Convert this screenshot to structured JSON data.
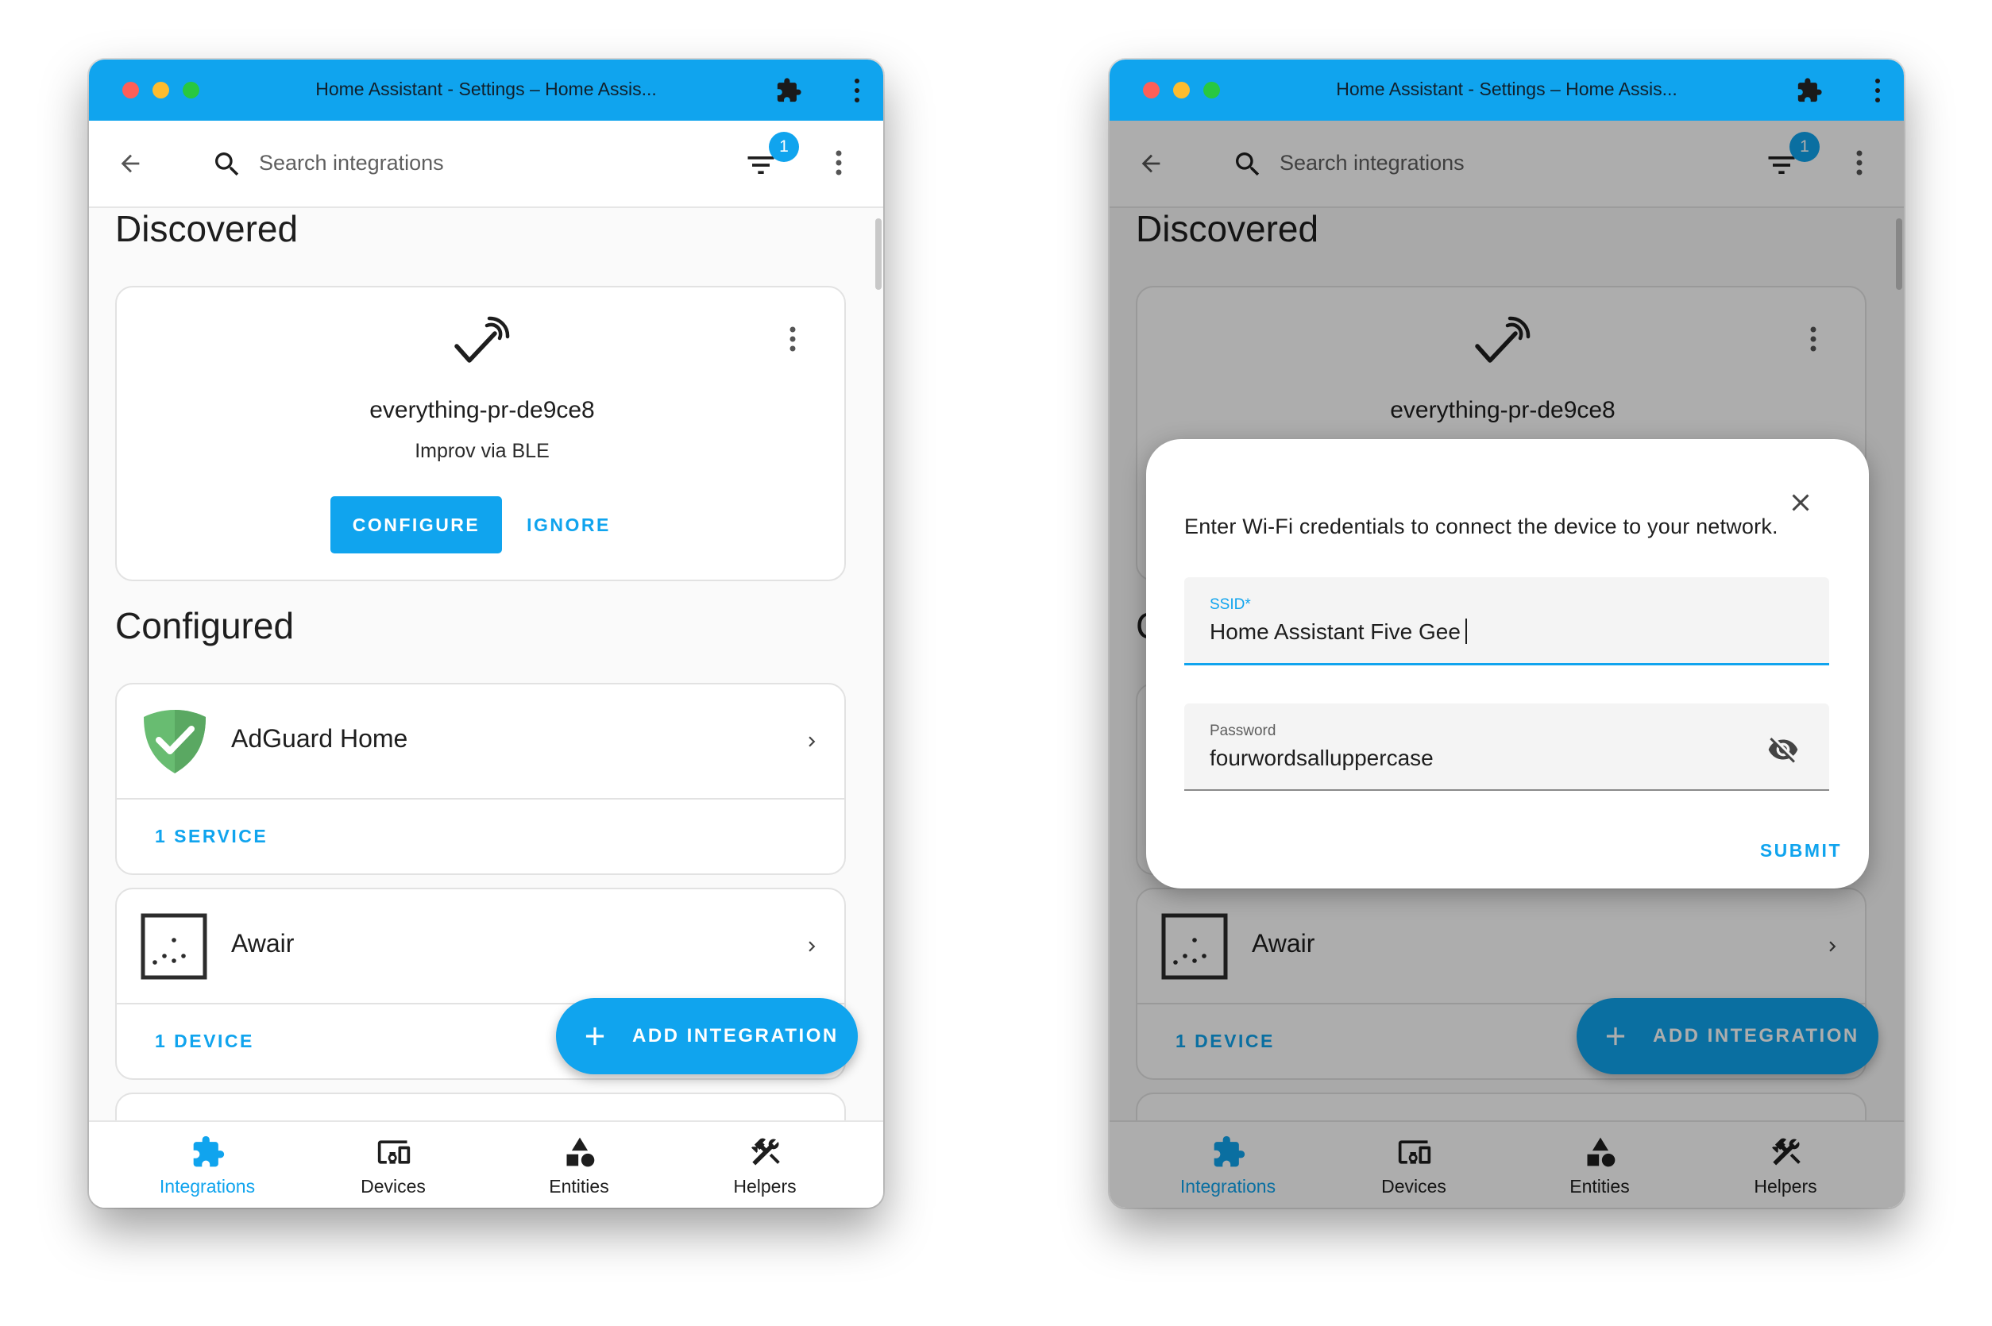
{
  "window": {
    "title": "Home Assistant - Settings – Home Assis..."
  },
  "toolbar": {
    "search_placeholder": "Search integrations",
    "filter_count": "1"
  },
  "discovered": {
    "heading": "Discovered",
    "card": {
      "name": "everything-pr-de9ce8",
      "subtitle": "Improv via BLE",
      "configure_label": "CONFIGURE",
      "ignore_label": "IGNORE"
    }
  },
  "configured": {
    "heading": "Configured",
    "items": [
      {
        "name": "AdGuard Home",
        "link": "1 SERVICE",
        "icon": "adguard-shield-icon"
      },
      {
        "name": "Awair",
        "link": "1 DEVICE",
        "icon": "awair-icon"
      }
    ]
  },
  "fab": {
    "label": "ADD INTEGRATION"
  },
  "nav": {
    "items": [
      {
        "label": "Integrations",
        "icon": "puzzle-icon",
        "active": true
      },
      {
        "label": "Devices",
        "icon": "devices-icon"
      },
      {
        "label": "Entities",
        "icon": "shapes-icon"
      },
      {
        "label": "Helpers",
        "icon": "tools-icon"
      }
    ]
  },
  "dialog": {
    "message": "Enter Wi-Fi credentials to connect the device to your network.",
    "ssid_label": "SSID*",
    "ssid_value": "Home Assistant Five Gee",
    "password_label": "Password",
    "password_value": "fourwordsalluppercase",
    "submit_label": "SUBMIT"
  },
  "colors": {
    "accent": "#10a4ee",
    "titlebar": "#10a4ee",
    "adguard_green": "#68bc71"
  }
}
